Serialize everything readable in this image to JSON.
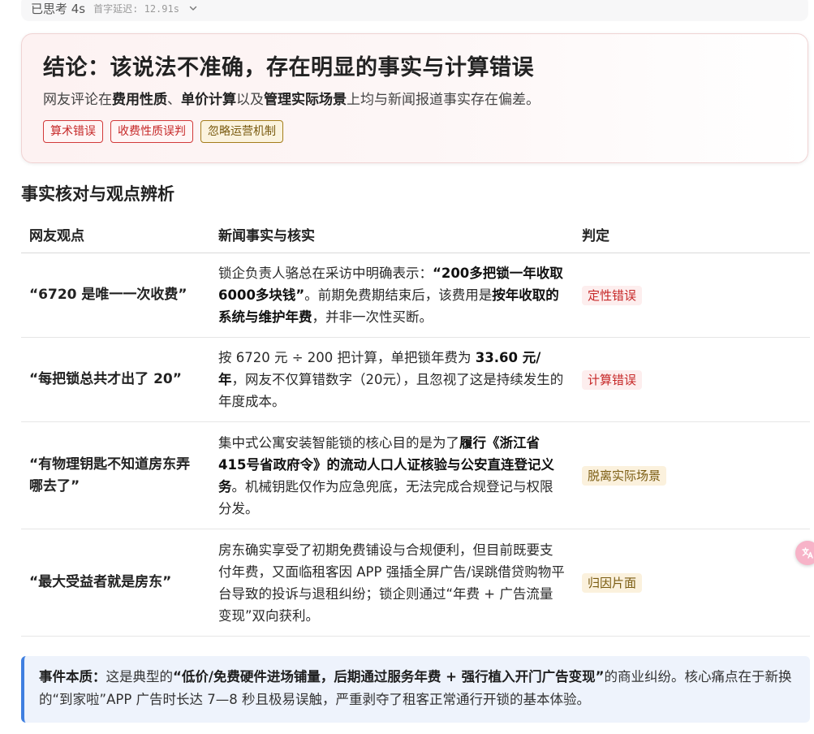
{
  "thinking": {
    "label": "已思考 4s",
    "latency": "首字延迟: 12.91s",
    "expand_icon": "chevron-down-icon"
  },
  "conclusion": {
    "title": "结论：该说法不准确，存在明显的事实与计算错误",
    "subtitle_parts": [
      "网友评论在",
      "费用性质",
      "、",
      "单价计算",
      "以及",
      "管理实际场景",
      "上均与新闻报道事实存在偏差。"
    ],
    "tags": [
      {
        "label": "算术错误",
        "tone": "red"
      },
      {
        "label": "收费性质误判",
        "tone": "red"
      },
      {
        "label": "忽略运营机制",
        "tone": "gold"
      }
    ]
  },
  "section_title": "事实核对与观点辨析",
  "table": {
    "headers": [
      "网友观点",
      "新闻事实与核实",
      "判定"
    ],
    "rows": [
      {
        "view": "“6720 是唯一一次收费”",
        "fact": [
          {
            "t": "锁企负责人骆总在采访中明确表示：",
            "b": false
          },
          {
            "t": "“200多把锁一年收取6000多块钱”",
            "b": true
          },
          {
            "t": "。前期免费期结束后，该费用是",
            "b": false
          },
          {
            "t": "按年收取的系统与维护年费",
            "b": true
          },
          {
            "t": "，并非一次性买断。",
            "b": false
          }
        ],
        "verdict": "定性错误",
        "tone": "red"
      },
      {
        "view": "“每把锁总共才出了 20”",
        "fact": [
          {
            "t": "按 6720 元 ÷ 200 把计算，单把锁年费为 ",
            "b": false
          },
          {
            "t": "33.60 元/年",
            "b": true
          },
          {
            "t": "，网友不仅算错数字（20元），且忽视了这是持续发生的年度成本。",
            "b": false
          }
        ],
        "verdict": "计算错误",
        "tone": "red"
      },
      {
        "view": "“有物理钥匙不知道房东弄哪去了”",
        "fact": [
          {
            "t": "集中式公寓安装智能锁的核心目的是为了",
            "b": false
          },
          {
            "t": "履行《浙江省415号省政府令》的流动人口人证核验与公安直连登记义务",
            "b": true
          },
          {
            "t": "。机械钥匙仅作为应急兜底，无法完成合规登记与权限分发。",
            "b": false
          }
        ],
        "verdict": "脱离实际场景",
        "tone": "gold"
      },
      {
        "view": "“最大受益者就是房东”",
        "fact": [
          {
            "t": "房东确实享受了初期免费铺设与合规便利，但目前既要支付年费，又面临租客因 APP 强插全屏广告/误跳借贷购物平台导致的投诉与退租纠纷；锁企则通过“年费 + 广告流量变现”双向获利。",
            "b": false
          }
        ],
        "verdict": "归因片面",
        "tone": "gold"
      }
    ]
  },
  "essence": {
    "label": "事件本质：",
    "parts": [
      {
        "t": "这是典型的",
        "b": false
      },
      {
        "t": "“低价/免费硬件进场铺量，后期通过服务年费 + 强行植入开门广告变现”",
        "b": true
      },
      {
        "t": "的商业纠纷。核心痛点在于新换的“到家啦”APP 广告时长达 7—8 秒且极易误触，严重剥夺了租客正常通行开锁的基本体验。",
        "b": false
      }
    ]
  },
  "floating_button_icon": "translate-icon"
}
